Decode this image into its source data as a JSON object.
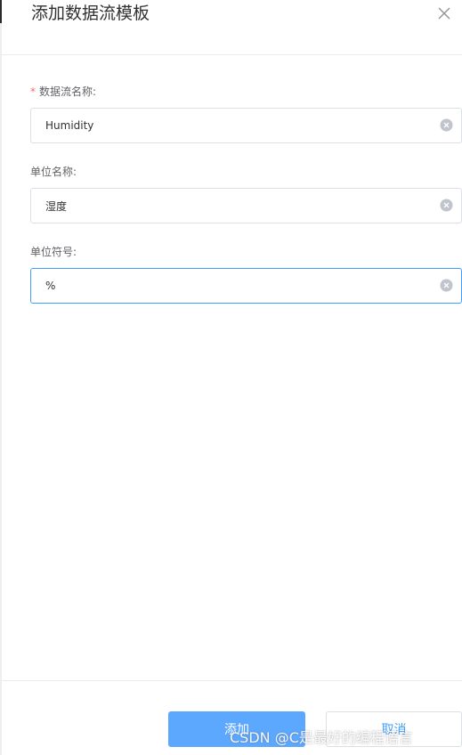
{
  "dialog": {
    "title": "添加数据流模板"
  },
  "form": {
    "required_mark": "*",
    "fields": [
      {
        "label": "数据流名称:",
        "value": "Humidity",
        "placeholder": ""
      },
      {
        "label": "单位名称:",
        "value": "湿度",
        "placeholder": ""
      },
      {
        "label": "单位符号:",
        "value": "%",
        "placeholder": ""
      }
    ]
  },
  "footer": {
    "confirm_label": "添加",
    "cancel_label": "取消"
  },
  "watermark": {
    "text": "CSDN @C是最好的编程语言"
  },
  "colors": {
    "primary": "#409eff",
    "primary_button": "#5da8ff",
    "required": "#f56c6c",
    "border": "#dcdfe6"
  },
  "icons": {
    "close": "close-icon",
    "clear": "circle-close-icon"
  }
}
